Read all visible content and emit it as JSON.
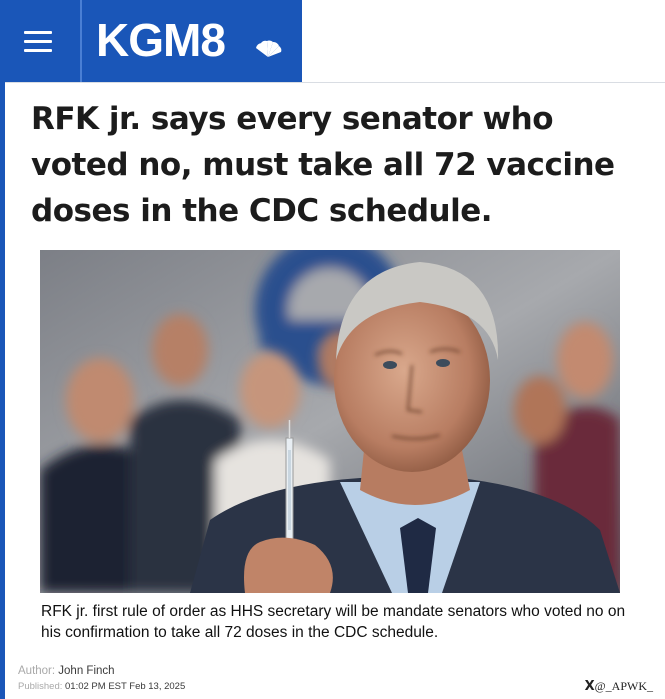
{
  "header": {
    "logo_text": "KGM8",
    "brand_color": "#1a56b8",
    "menu_icon": "hamburger-menu-icon",
    "network_icon": "peacock-logo-icon"
  },
  "article": {
    "headline": "RFK jr. says every senator who voted no, must take all 72 vaccine doses in the CDC schedule.",
    "photo_icon": "news-photo",
    "caption": "RFK jr. first rule of order as HHS secretary  will be mandate senators who voted no on his confirmation to take all 72 doses in the CDC schedule.",
    "author_label": "Author:",
    "author_name": "John Finch",
    "published_label": "Published:",
    "published_value": "01:02 PM EST Feb 13, 2025"
  },
  "watermark": {
    "x_glyph": "X",
    "handle": "@_APWK_"
  }
}
